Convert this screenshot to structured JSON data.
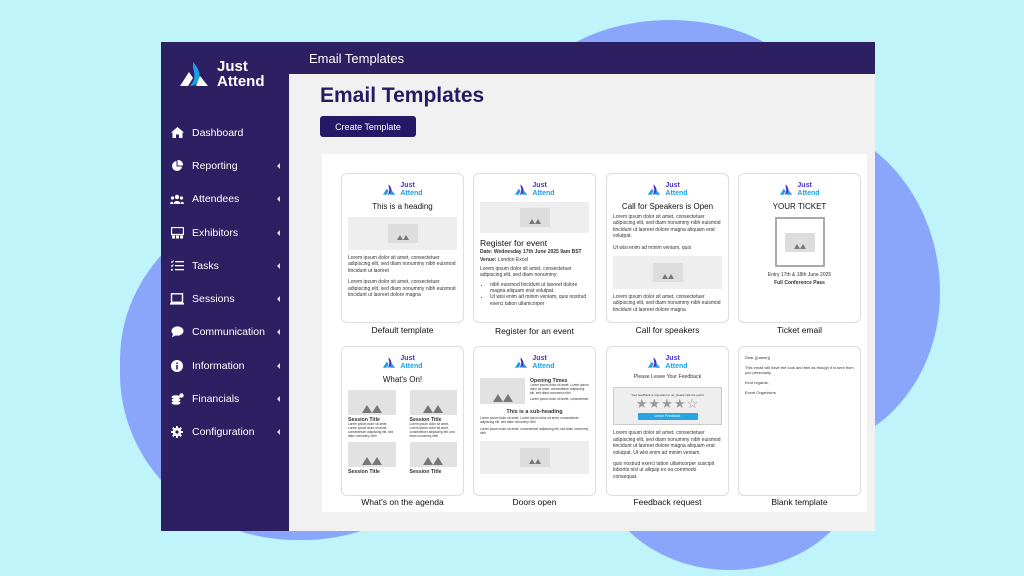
{
  "app": {
    "logo": {
      "line1": "Just",
      "line2": "Attend"
    },
    "topbar_title": "Email Templates"
  },
  "sidebar": {
    "items": [
      {
        "label": "Dashboard",
        "icon": "home-icon",
        "has_caret": false
      },
      {
        "label": "Reporting",
        "icon": "pie-chart-icon",
        "has_caret": true
      },
      {
        "label": "Attendees",
        "icon": "users-icon",
        "has_caret": true
      },
      {
        "label": "Exhibitors",
        "icon": "exhibitors-icon",
        "has_caret": true
      },
      {
        "label": "Tasks",
        "icon": "tasks-icon",
        "has_caret": true
      },
      {
        "label": "Sessions",
        "icon": "laptop-icon",
        "has_caret": true
      },
      {
        "label": "Communication",
        "icon": "chat-icon",
        "has_caret": true
      },
      {
        "label": "Information",
        "icon": "info-icon",
        "has_caret": true
      },
      {
        "label": "Financials",
        "icon": "coins-icon",
        "has_caret": true
      },
      {
        "label": "Configuration",
        "icon": "gear-icon",
        "has_caret": true
      }
    ]
  },
  "main": {
    "page_title": "Email Templates",
    "create_button": "Create Template",
    "templates": [
      {
        "label": "Default template",
        "heading": "This is a heading",
        "para1": "Lorem ipsum dolor sit amet, consectetuer adipiscing elit, sed diam nonummy nibh euismod tincidunt ut laoreet",
        "para2": "Lorem ipsum dolor sit amet, consectetuer adipiscing elit, sed diam nonummy nibh euismod tincidunt ut laoreet dolore magna"
      },
      {
        "label": "Register for an event",
        "heading": "Register for event",
        "date": "Date: Wednesday 17th June 2025 9am BST",
        "venue_label": "Venue:",
        "venue": "London Excel",
        "para1": "Lorem ipsum dolor sit amet, consectetuer adipiscing elit, sed diam nonummy:",
        "bullets": [
          "nibh euismod tincidunt ut laoreet dolore magna aliquam erat volutpat.",
          "Ut wisi enim ad minim veniam, quis nostrud exerci tation ullamcorper"
        ]
      },
      {
        "label": "Call for speakers",
        "heading": "Call for Speakers is Open",
        "para1": "Lorem ipsum dolor sit amet, consectetuer adipiscing elit, sed diam nonummy nibh euismod tincidunt ut laoreet dolore magna aliquam erat volutpat.",
        "para2": "Ut wisi enim ad minim veniam, quis",
        "para3": "Lorem ipsum dolor sit amet, consectetuer adipiscing elit, sed diam nonummy nibh euismod tincidunt ut laoreet dolore magna"
      },
      {
        "label": "Ticket email",
        "heading": "YOUR TICKET",
        "entry": "Entry 17th & 18th June 2025",
        "pass": "Full Conference Pass"
      },
      {
        "label": "What's on the agenda",
        "heading": "What's On!",
        "session_title": "Session Title",
        "session_text": "Lorem ipsum dolor sit amet, Lorem ipsum dolor sit amet, consectetuer adipiscing elit, sed diam nonummy nibh"
      },
      {
        "label": "Doors open",
        "side_heading": "Opening Times",
        "side_text1": "Lorem ipsum dolor sit amet, Lorem ipsum dolor sit amet, consectetuer adipiscing elit, sed diam nonummy nibh",
        "side_text2": "Lorem ipsum dolor sit amet, consectetuer",
        "sub_heading": "This is a sub-heading",
        "para1": "Lorem ipsum dolor sit amet, Lorem ipsum dolor sit amet, consectetuer adipiscing elit, sed diam nonummy nibh",
        "para2": "Lorem ipsum dolor sit amet, consectetuer adipiscing elit, sed diam nonummy nibh"
      },
      {
        "label": "Feedback request",
        "heading": "Please Leave Your Feedback",
        "prompt": "Your feedback is important to us, please rate the event",
        "rating": 4,
        "rating_max": 5,
        "stars": "★★★★☆",
        "button": "Leave Feedback",
        "para1": "Lorem ipsum dolor sit amet, consectetuer adipiscing elit, sed diam nonummy nibh euismod tincidunt ut laoreet dolore magna aliquam erat volutpat. Ut wisi enim ad minim veniam.",
        "para2": "quis nostrud exerci tation ullamcorper suscipit lobortis nisl ut aliquip ex ea commodo consequat."
      },
      {
        "label": "Blank template",
        "greeting": "Dear {{name}}",
        "para1": "This email will have the look and feel as though it is sent from you personally.",
        "regards": "Kind regards,",
        "signoff": "Event Organisers"
      }
    ]
  },
  "colors": {
    "sidebar_bg": "#2c1f62",
    "accent": "#241867",
    "logo_purple": "#4b2fc7",
    "logo_blue": "#1aa0e8",
    "background": "#bff4fb",
    "blob": "#8aa6fb"
  }
}
